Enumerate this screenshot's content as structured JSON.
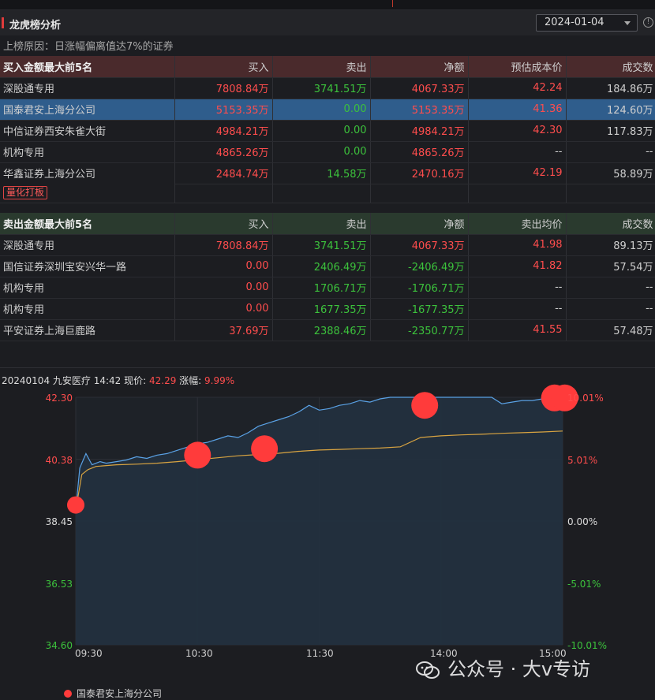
{
  "header": {
    "title": "龙虎榜分析",
    "date": "2024-01-04",
    "reason": "上榜原因：日涨幅偏离值达7%的证券"
  },
  "buy_table": {
    "columns": [
      "买入金额最大前5名",
      "买入",
      "卖出",
      "净额",
      "预估成本价",
      "成交数"
    ],
    "rows": [
      {
        "name": "深股通专用",
        "buy": "7808.84万",
        "sell": "3741.51万",
        "net": "4067.33万",
        "price": "42.24",
        "volume": "184.86万"
      },
      {
        "name": "国泰君安上海分公司",
        "buy": "5153.35万",
        "sell": "0.00",
        "net": "5153.35万",
        "price": "41.36",
        "volume": "124.60万"
      },
      {
        "name": "中信证券西安朱雀大街",
        "buy": "4984.21万",
        "sell": "0.00",
        "net": "4984.21万",
        "price": "42.30",
        "volume": "117.83万"
      },
      {
        "name": "机构专用",
        "buy": "4865.26万",
        "sell": "0.00",
        "net": "4865.26万",
        "price": "--",
        "volume": "--"
      },
      {
        "name": "华鑫证券上海分公司",
        "buy": "2484.74万",
        "sell": "14.58万",
        "net": "2470.16万",
        "price": "42.19",
        "volume": "58.89万"
      }
    ],
    "tag": "量化打板"
  },
  "sell_table": {
    "columns": [
      "卖出金额最大前5名",
      "买入",
      "卖出",
      "净额",
      "卖出均价",
      "成交数"
    ],
    "rows": [
      {
        "name": "深股通专用",
        "buy": "7808.84万",
        "sell": "3741.51万",
        "net": "4067.33万",
        "price": "41.98",
        "volume": "89.13万"
      },
      {
        "name": "国信证券深圳宝安兴华一路",
        "buy": "0.00",
        "sell": "2406.49万",
        "net": "-2406.49万",
        "price": "41.82",
        "volume": "57.54万"
      },
      {
        "name": "机构专用",
        "buy": "0.00",
        "sell": "1706.71万",
        "net": "-1706.71万",
        "price": "--",
        "volume": "--"
      },
      {
        "name": "机构专用",
        "buy": "0.00",
        "sell": "1677.35万",
        "net": "-1677.35万",
        "price": "--",
        "volume": "--"
      },
      {
        "name": "平安证券上海巨鹿路",
        "buy": "37.69万",
        "sell": "2388.46万",
        "net": "-2350.77万",
        "price": "41.55",
        "volume": "57.48万"
      }
    ]
  },
  "chart_info": {
    "prefix": "20240104 九安医疗 14:42 现价:",
    "price": "42.29",
    "change_label": "涨幅:",
    "change": "9.99%"
  },
  "legend": "国泰君安上海分公司",
  "watermark": "公众号 · 大v专访",
  "chart_data": {
    "type": "line",
    "title": "",
    "x_ticks": [
      "09:30",
      "10:30",
      "11:30",
      "14:00",
      "15:00"
    ],
    "y_ticks": [
      "42.30",
      "40.38",
      "38.45",
      "36.53",
      "34.60"
    ],
    "y_pct_ticks": [
      "10.01%",
      "5.01%",
      "0.00%",
      "-5.01%",
      "-10.01%"
    ],
    "ylim": [
      34.6,
      42.3
    ],
    "minutes_total": 240,
    "series": [
      {
        "name": "",
        "role": "price",
        "color": "#5aa2e6",
        "x": [
          0,
          2,
          5,
          8,
          12,
          15,
          20,
          25,
          30,
          35,
          40,
          45,
          50,
          55,
          60,
          65,
          70,
          75,
          80,
          85,
          90,
          95,
          100,
          105,
          110,
          115,
          120,
          125,
          130,
          135,
          140,
          145,
          150,
          155,
          160,
          165,
          170,
          175,
          180,
          185,
          190,
          195,
          200,
          205,
          210,
          215,
          220,
          225,
          230,
          235,
          240
        ],
        "y": [
          38.8,
          40.1,
          40.55,
          40.2,
          40.3,
          40.25,
          40.3,
          40.35,
          40.45,
          40.4,
          40.5,
          40.55,
          40.65,
          40.75,
          40.85,
          40.9,
          41.0,
          41.1,
          41.05,
          41.2,
          41.4,
          41.5,
          41.6,
          41.7,
          41.85,
          42.05,
          41.9,
          41.95,
          42.05,
          42.1,
          42.2,
          42.15,
          42.25,
          42.3,
          42.3,
          42.3,
          42.3,
          42.3,
          42.3,
          42.3,
          42.3,
          42.3,
          42.3,
          42.3,
          42.1,
          42.15,
          42.2,
          42.2,
          42.25,
          42.25,
          42.29
        ]
      },
      {
        "name": "",
        "role": "average",
        "color": "#d9a441",
        "x": [
          0,
          3,
          6,
          10,
          20,
          30,
          40,
          50,
          60,
          70,
          80,
          90,
          100,
          110,
          120,
          130,
          140,
          150,
          160,
          170,
          180,
          190,
          200,
          210,
          220,
          230,
          240
        ],
        "y": [
          38.8,
          39.9,
          40.05,
          40.15,
          40.2,
          40.22,
          40.25,
          40.3,
          40.36,
          40.42,
          40.48,
          40.52,
          40.56,
          40.62,
          40.66,
          40.68,
          40.7,
          40.72,
          40.76,
          41.05,
          41.1,
          41.13,
          41.15,
          41.18,
          41.2,
          41.22,
          41.25
        ]
      }
    ],
    "trades": [
      {
        "x": 0,
        "y": 38.95
      },
      {
        "x": 60,
        "y": 40.5
      },
      {
        "x": 93,
        "y": 40.7
      },
      {
        "x": 172,
        "y": 42.05
      },
      {
        "x": 236,
        "y": 42.28
      },
      {
        "x": 241,
        "y": 42.28
      }
    ]
  }
}
